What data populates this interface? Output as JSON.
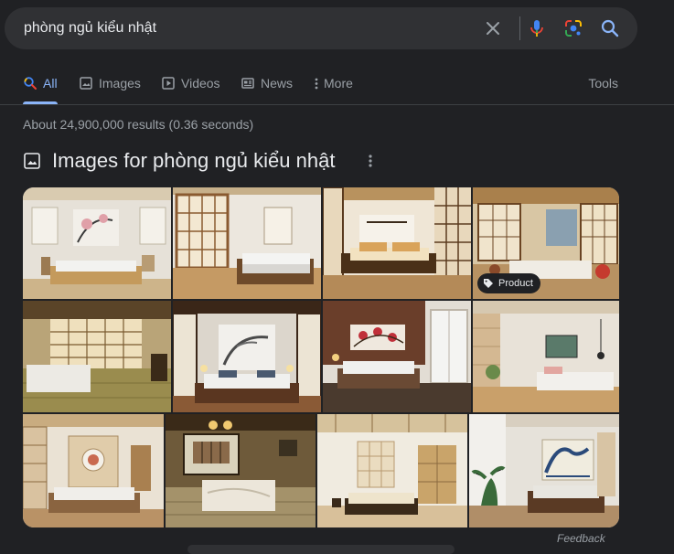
{
  "search": {
    "query": "phòng ngủ kiểu nhật",
    "clear_icon": "close-icon",
    "voice_icon": "microphone-icon",
    "lens_icon": "google-lens-icon",
    "search_icon": "search-icon"
  },
  "tabs": [
    {
      "label": "All",
      "icon": "search-icon",
      "active": true
    },
    {
      "label": "Images",
      "icon": "image-icon",
      "active": false
    },
    {
      "label": "Videos",
      "icon": "play-icon",
      "active": false
    },
    {
      "label": "News",
      "icon": "newspaper-icon",
      "active": false
    },
    {
      "label": "More",
      "icon": "vertical-dots-icon",
      "active": false
    }
  ],
  "tools_label": "Tools",
  "result_stats": "About 24,900,000 results (0.36 seconds)",
  "images_section": {
    "title": "Images for phòng ngủ kiểu nhật",
    "badge_label": "Product"
  },
  "feedback_label": "Feedback",
  "colors": {
    "background": "#202124",
    "accent": "#8ab4f8",
    "muted": "#9aa0a6"
  }
}
